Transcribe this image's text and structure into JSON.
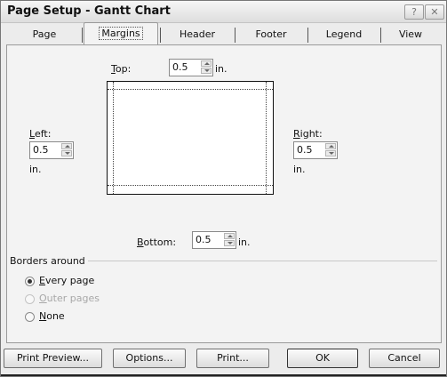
{
  "window": {
    "title": "Page Setup - Gantt Chart",
    "help_glyph": "?",
    "close_glyph": "✕"
  },
  "tabs": [
    {
      "label": "Page",
      "active": false
    },
    {
      "label": "Margins",
      "active": true
    },
    {
      "label": "Header",
      "active": false
    },
    {
      "label": "Footer",
      "active": false
    },
    {
      "label": "Legend",
      "active": false
    },
    {
      "label": "View",
      "active": false
    }
  ],
  "margins": {
    "top": {
      "label_first": "T",
      "label_rest": "op:",
      "value": "0.5",
      "unit": "in."
    },
    "left": {
      "label_first": "L",
      "label_rest": "eft:",
      "value": "0.5",
      "unit": "in."
    },
    "right": {
      "label_first": "R",
      "label_rest": "ight:",
      "value": "0.5",
      "unit": "in."
    },
    "bottom": {
      "label_first": "B",
      "label_rest": "ottom:",
      "value": "0.5",
      "unit": "in."
    }
  },
  "borders": {
    "label": "Borders around",
    "options": [
      {
        "first": "E",
        "rest": "very page",
        "checked": true,
        "disabled": false
      },
      {
        "first": "O",
        "rest": "uter pages",
        "checked": false,
        "disabled": true
      },
      {
        "first": "N",
        "rest": "one",
        "checked": false,
        "disabled": false
      }
    ]
  },
  "buttons": {
    "print_preview": "Print Preview...",
    "options": "Options...",
    "print": "Print...",
    "ok": "OK",
    "cancel": "Cancel"
  },
  "icons": {
    "help": "help-icon",
    "close": "close-icon",
    "spin_up": "spin-up-icon",
    "spin_down": "spin-down-icon"
  }
}
